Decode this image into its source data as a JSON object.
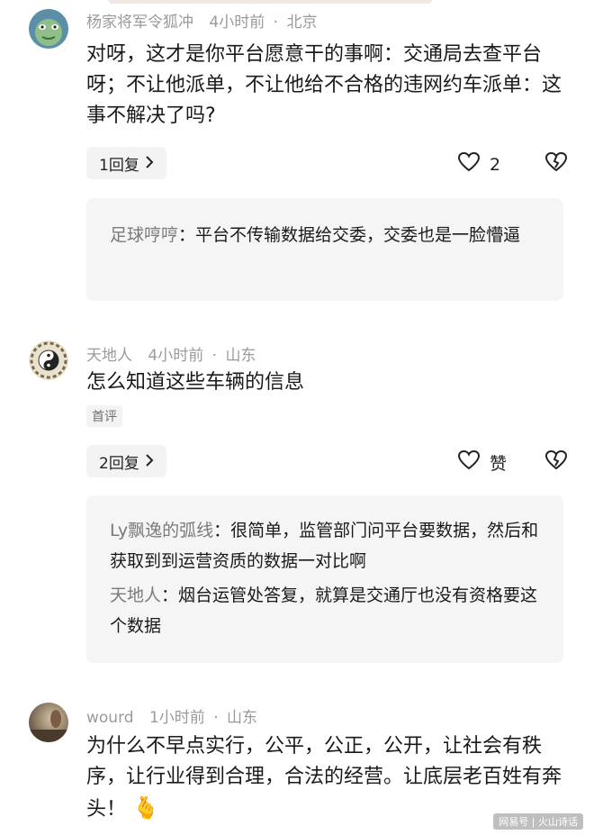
{
  "comments": [
    {
      "username": "杨家将军令狐冲",
      "time": "4小时前",
      "location": "北京",
      "text": "对呀，这才是你平台愿意干的事啊：交通局去查平台呀；不让他派单，不让他给不合格的违网约车派单：这事不解决了吗?",
      "reply_label": "1回复",
      "like_count": "2",
      "replies": [
        {
          "name": "足球哼哼",
          "sep": "：",
          "text": "平台不传输数据给交委，交委也是一脸懵逼"
        }
      ]
    },
    {
      "username": "天地人",
      "time": "4小时前",
      "location": "山东",
      "text": "怎么知道这些车辆的信息",
      "tag": "首评",
      "reply_label": "2回复",
      "like_count": "赞",
      "replies": [
        {
          "name": "Ly飘逸的弧线",
          "sep": "：",
          "text": "很简单，监管部门问平台要数据，然后和获取到到运营资质的数据一对比啊"
        },
        {
          "name": "天地人",
          "sep": "：",
          "text": "烟台运管处答复，就算是交通厅也没有资格要这个数据"
        }
      ]
    },
    {
      "username": "wourd",
      "time": "1小时前",
      "location": "山东",
      "text": "为什么不早点实行，公平，公正，公开，让社会有秩序，让行业得到合理，合法的经营。让底层老百姓有奔头！",
      "emoji": "🫰"
    }
  ],
  "separator": "·",
  "watermark": "网易号 | 火山诗话",
  "icons": {
    "like": "heart-outline-icon",
    "dislike": "broken-heart-icon",
    "chevron": "chevron-right-icon"
  }
}
